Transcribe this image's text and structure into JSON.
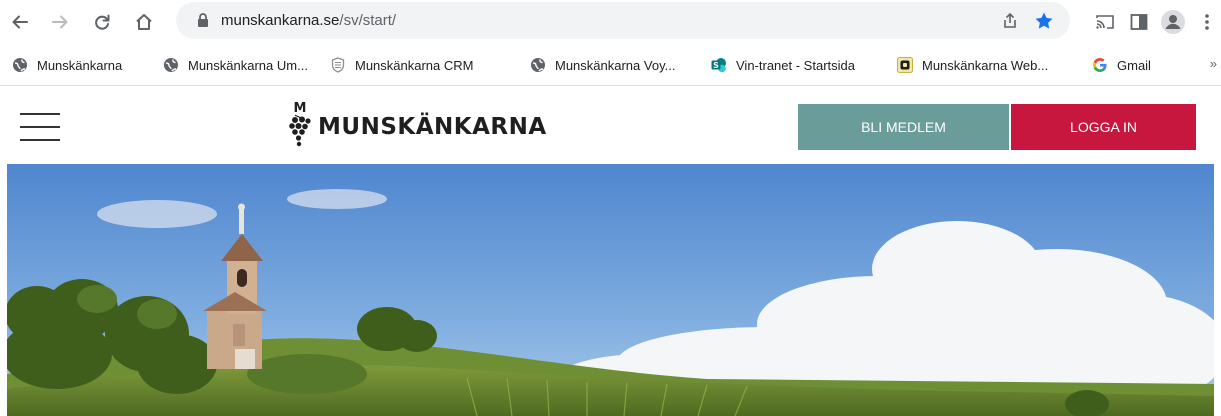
{
  "browser": {
    "url_host": "munskankarna.se",
    "url_path": "/sv/start/",
    "nav_icons": [
      "back-arrow-icon",
      "forward-arrow-icon",
      "reload-icon",
      "home-icon"
    ],
    "omnibox_icons": [
      "lock-icon",
      "share-icon",
      "bookmark-star-icon"
    ],
    "right_icons": [
      "cast-icon",
      "side-panel-icon",
      "profile-avatar-icon",
      "more-menu-icon"
    ],
    "star_color": "#1a73e8"
  },
  "bookmarks": {
    "items": [
      {
        "label": "Munskänkarna",
        "icon": "globe-icon"
      },
      {
        "label": "Munskänkarna Um...",
        "icon": "globe-icon"
      },
      {
        "label": "Munskänkarna CRM",
        "icon": "crm-shield-icon"
      },
      {
        "label": "Munskänkarna Voy...",
        "icon": "globe-icon"
      },
      {
        "label": "Vin-tranet - Startsida",
        "icon": "sharepoint-icon"
      },
      {
        "label": "Munskänkarna Web...",
        "icon": "web-app-icon"
      },
      {
        "label": "Gmail",
        "icon": "google-icon"
      }
    ],
    "overflow": "»"
  },
  "site": {
    "logo_text": "MUNSKÄNKARNA",
    "logo_initial": "M",
    "menu_icon": "hamburger-menu-icon",
    "member_button": "BLI MEDLEM",
    "login_button": "LOGGA IN",
    "member_color": "#6a9c99",
    "login_color": "#c7173f"
  }
}
